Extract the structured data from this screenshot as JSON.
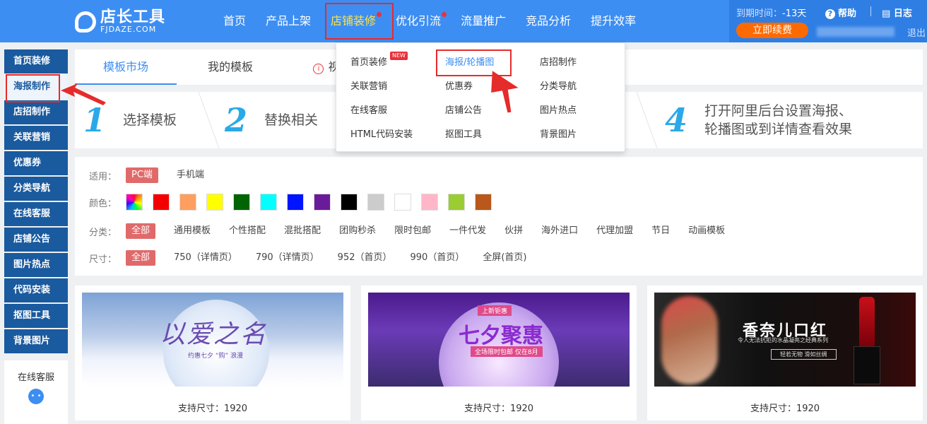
{
  "header": {
    "logo_text": "店长工具",
    "logo_sub": "FJDAZE.COM",
    "nav": [
      {
        "label": "首页",
        "dot": false
      },
      {
        "label": "产品上架",
        "dot": false
      },
      {
        "label": "店铺装修",
        "dot": true,
        "active": true
      },
      {
        "label": "优化引流",
        "dot": true
      },
      {
        "label": "流量推广",
        "dot": false
      },
      {
        "label": "竞品分析",
        "dot": false
      },
      {
        "label": "提升效率",
        "dot": false
      }
    ],
    "expire_label": "到期时间：",
    "expire_value": "-13天",
    "renew": "立即续费",
    "help": "帮助",
    "log": "日志",
    "logout": "退出"
  },
  "dropdown": {
    "new_badge": "NEW",
    "col1": [
      "首页装修",
      "关联营销",
      "在线客服",
      "HTML代码安装"
    ],
    "col2": [
      "海报/轮播图",
      "优惠券",
      "店铺公告",
      "抠图工具"
    ],
    "col3": [
      "店招制作",
      "分类导航",
      "图片热点",
      "背景图片"
    ]
  },
  "sidebar": {
    "items": [
      "首页装修",
      "海报制作",
      "店招制作",
      "关联营销",
      "优惠券",
      "分类导航",
      "在线客服",
      "店铺公告",
      "图片热点",
      "代码安装",
      "抠图工具",
      "背景图片"
    ],
    "active_index": 1,
    "kefu": "在线客服"
  },
  "tabs": {
    "items": [
      "模板市场",
      "我的模板"
    ],
    "partial": "视"
  },
  "steps": [
    {
      "num": "1",
      "text": "选择模板"
    },
    {
      "num": "2",
      "text": "替换相关"
    },
    {
      "num": "4",
      "text_line1": "打开阿里后台设置海报、",
      "text_line2": "轮播图或到详情查看效果"
    }
  ],
  "filter": {
    "apply_label": "适用：",
    "apply_options": [
      "PC端",
      "手机端"
    ],
    "color_label": "颜色：",
    "colors": [
      "rainbow",
      "#f40000",
      "#ff9e5e",
      "#ffff00",
      "#006400",
      "#00ffff",
      "#0014ff",
      "#6a1b9a",
      "#000000",
      "#cccccc",
      "#ffffff",
      "#ffb6c8",
      "#9acd32",
      "#b9581a"
    ],
    "category_label": "分类：",
    "categories": [
      "全部",
      "通用模板",
      "个性搭配",
      "混批搭配",
      "团购秒杀",
      "限时包邮",
      "一件代发",
      "伙拼",
      "海外进口",
      "代理加盟",
      "节日",
      "动画模板"
    ],
    "size_label": "尺寸：",
    "sizes": [
      "全部",
      "750（详情页）",
      "790（详情页）",
      "952（首页）",
      "990（首页）",
      "全屏(首页)"
    ]
  },
  "cards": [
    {
      "caption": "支持尺寸：1920",
      "title": "以爱之名",
      "sub": "约惠七夕 “购” 浪漫"
    },
    {
      "caption": "支持尺寸：1920",
      "title": "七夕聚惠",
      "tag": "上新钜惠",
      "sub": "全场限时包邮 仅在8月"
    },
    {
      "caption": "支持尺寸：1920",
      "title": "香奈儿口红",
      "sub": "令人无法抗拒的水晶凝亮之经典系列",
      "btn": "轻若无物  滑如丝绸"
    }
  ],
  "colors": {
    "brand": "#3d8ef2",
    "sidebar": "#1a5a9e",
    "highlight": "#e62b2b",
    "renew": "#ff6a00"
  }
}
